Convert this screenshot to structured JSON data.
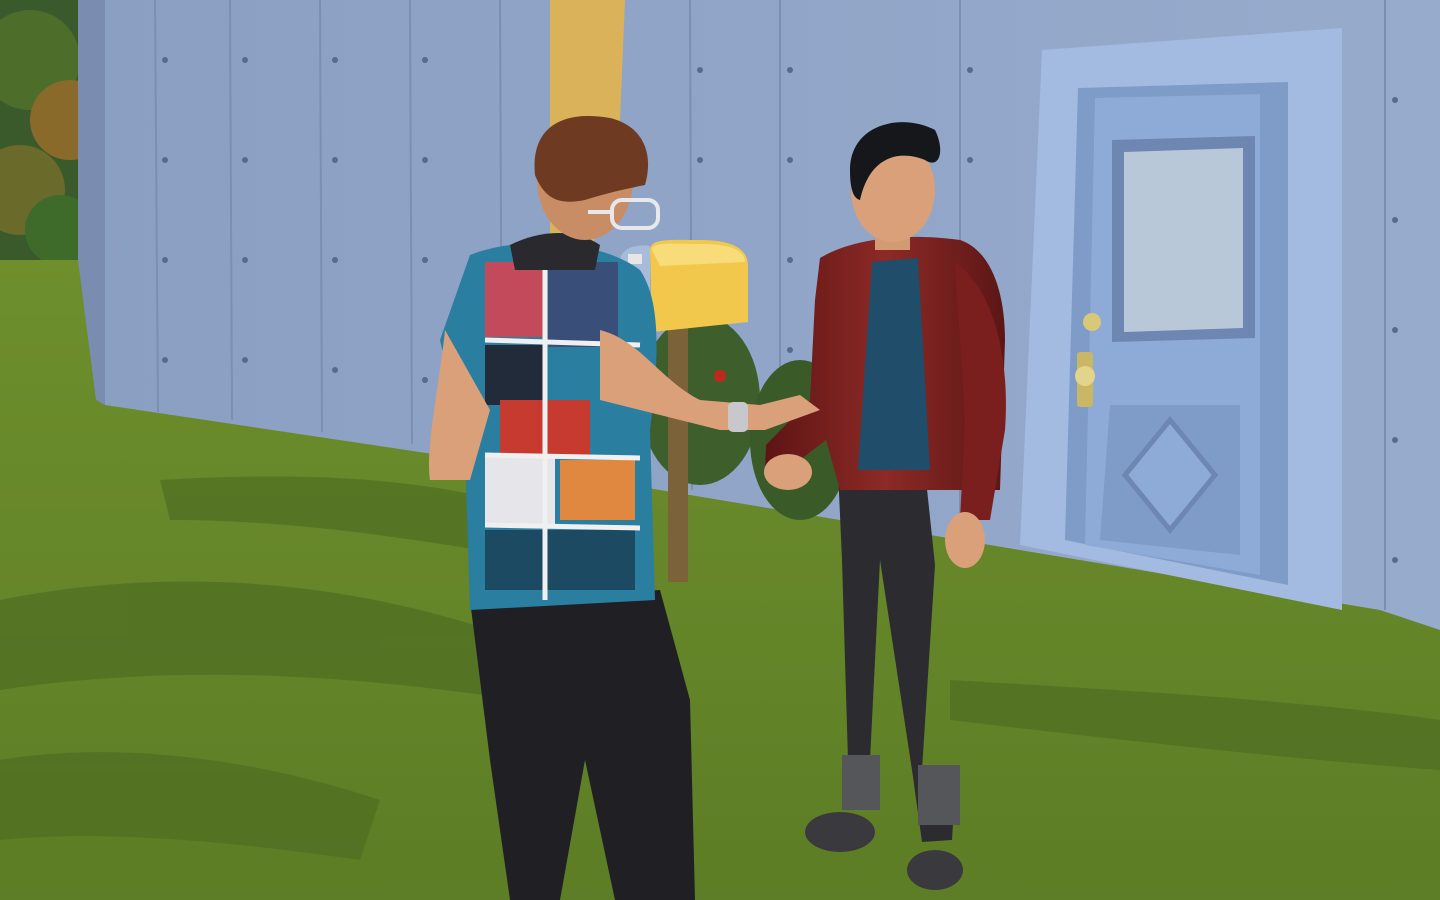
{
  "scene": {
    "type": "3d-game-viewport",
    "description_elements": [
      "house-wall",
      "front-door",
      "mailbox",
      "shrub",
      "lawn",
      "sim-left",
      "sim-right"
    ]
  },
  "colors": {
    "sky_foliage": "#3d5a2a",
    "wall": "#8fa3c4",
    "wall_shadow": "#6f82a6",
    "door_frame": "#9bb3d8",
    "door": "#8aa6d0",
    "mailbox": "#f2c44a",
    "mailbox_post": "#8a6b3a",
    "grass_light": "#7a9a30",
    "grass_dark": "#4c6e28",
    "jacket": "#7a1e1e",
    "shirt_blue": "#1f4f6a",
    "jeans": "#2a2a2e",
    "hair_left": "#6b3a22",
    "hair_right": "#121418",
    "skin": "#d9a07a"
  }
}
